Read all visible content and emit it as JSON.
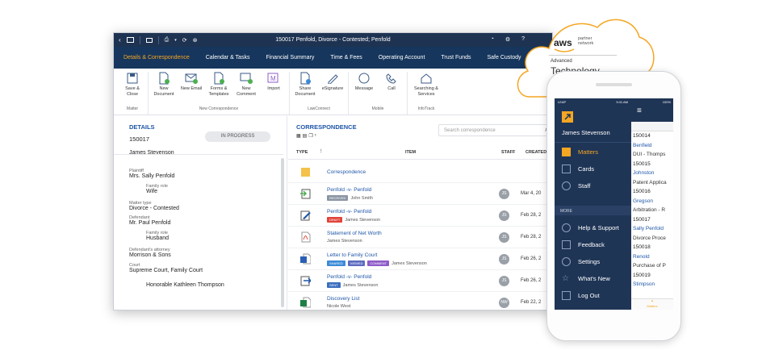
{
  "app": {
    "title": "150017 Penfold, Divorce - Contested; Penfold",
    "tabs": [
      "Details & Correspondence",
      "Calendar & Tasks",
      "Financial Summary",
      "Time & Fees",
      "Operating Account",
      "Trust Funds",
      "Safe Custody"
    ],
    "ribbon": {
      "groups": [
        {
          "label": "Matter",
          "buttons": [
            "Save & Close"
          ]
        },
        {
          "label": "New Correspondence",
          "buttons": [
            "New Document",
            "New Email",
            "Forms & Templates",
            "New Comment",
            "Import"
          ]
        },
        {
          "label": "LawConnect",
          "buttons": [
            "Share Document",
            "eSignature"
          ]
        },
        {
          "label": "Mobile",
          "buttons": [
            "Message",
            "Call"
          ]
        },
        {
          "label": "InfoTrack",
          "buttons": [
            "Searching & Services"
          ]
        }
      ]
    },
    "details": {
      "heading": "DETAILS",
      "matter_number": "150017",
      "status": "IN PROGRESS",
      "client": "James Stevenson",
      "plaintiff_label": "Plaintiff",
      "plaintiff": "Mrs. Sally Penfold",
      "family_role_label": "Family role",
      "plaintiff_role": "Wife",
      "matter_type_label": "Matter type",
      "matter_type": "Divorce - Contested",
      "defendant_label": "Defendant",
      "defendant": "Mr. Paul Penfold",
      "defendant_role": "Husband",
      "attorney_label": "Defendant's attorney",
      "attorney": "Morrison & Sons",
      "court_label": "Court",
      "court": "Supreme Court, Family Court",
      "judge": "Honorable Kathleen Thompson"
    },
    "correspondence": {
      "heading": "CORRESPONDENCE",
      "search_placeholder": "Search correspondence",
      "columns": {
        "type": "TYPE",
        "item": "ITEM",
        "staff": "STAFF",
        "created": "CREATED"
      },
      "rows": [
        {
          "icon": "folder-icon",
          "title": "Correspondence"
        },
        {
          "icon": "received-icon",
          "title": "Penfold -v- Penfold",
          "badges": [
            "RECEIVED"
          ],
          "person": "John Smith",
          "staff": "JS",
          "date": "Mar 4, 20"
        },
        {
          "icon": "draft-icon",
          "title": "Penfold -v- Penfold",
          "badges": [
            "DRAFT"
          ],
          "person": "James Stevenson",
          "staff": "JS",
          "date": "Feb 28, 2"
        },
        {
          "icon": "pdf-icon",
          "title": "Statement of Net Worth",
          "person": "James Stevenson",
          "staff": "JS",
          "date": "Feb 28, 2"
        },
        {
          "icon": "word-icon",
          "title": "Letter to Family Court",
          "badges": [
            "SHARED",
            "VIEWED",
            "COMMENT"
          ],
          "person": "James Stevenson",
          "staff": "JS",
          "date": "Feb 26, 2"
        },
        {
          "icon": "sent-icon",
          "title": "Penfold -v- Penfold",
          "badges": [
            "SENT"
          ],
          "person": "James Stevenson",
          "staff": "JS",
          "date": "Feb 26, 2"
        },
        {
          "icon": "excel-icon",
          "title": "Discovery List",
          "person": "Nicole West",
          "staff": "NW",
          "date": "Feb 22, 2"
        }
      ]
    }
  },
  "badge_colors": {
    "RECEIVED": "#8a95a3",
    "DRAFT": "#e0443a",
    "SHARED": "#3d8ad8",
    "VIEWED": "#5c6bc0",
    "COMMENT": "#8e5cc9",
    "SENT": "#3d6fbf"
  },
  "aws": {
    "logo": "aws",
    "partner_network": "partner network",
    "level": "Advanced",
    "title": "Technology Partner"
  },
  "phone": {
    "carrier": "LEAP",
    "time": "9:41 AM",
    "battery": "100%",
    "user": "James Stevenson",
    "menu": [
      "Matters",
      "Cards",
      "Staff"
    ],
    "more_label": "MORE",
    "more_menu": [
      "Help & Support",
      "Feedback",
      "Settings",
      "What's New",
      "Log Out"
    ],
    "list": [
      {
        "text": "150014",
        "kind": "num"
      },
      {
        "text": "Benfield",
        "kind": "name"
      },
      {
        "text": "DUI - Thomps",
        "kind": "desc"
      },
      {
        "text": "150015",
        "kind": "num"
      },
      {
        "text": "Johnston",
        "kind": "name"
      },
      {
        "text": "Patent Applica",
        "kind": "desc"
      },
      {
        "text": "150016",
        "kind": "num"
      },
      {
        "text": "Gregson",
        "kind": "name"
      },
      {
        "text": "Arbitration - R",
        "kind": "desc"
      },
      {
        "text": "150017",
        "kind": "num"
      },
      {
        "text": "Sally Penfold",
        "kind": "name"
      },
      {
        "text": "Divorce Proce",
        "kind": "desc"
      },
      {
        "text": "150018",
        "kind": "num"
      },
      {
        "text": "Renold",
        "kind": "name"
      },
      {
        "text": "Purchase of P",
        "kind": "desc"
      },
      {
        "text": "150019",
        "kind": "num"
      },
      {
        "text": "Stimpson",
        "kind": "name"
      }
    ],
    "tab_label": "Matters"
  },
  "colors": {
    "navy": "#16365d",
    "accent": "#f5a623",
    "link": "#1f56a8"
  }
}
